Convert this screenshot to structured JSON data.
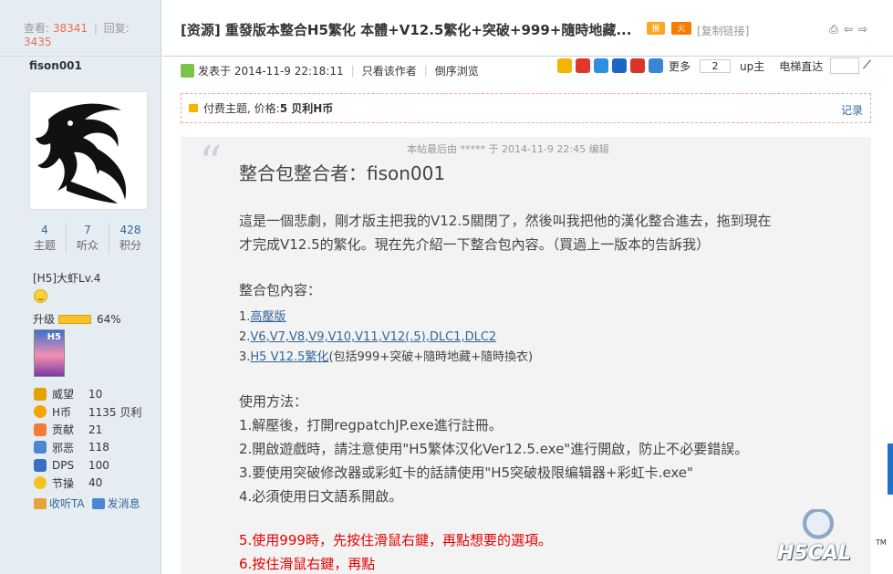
{
  "left": {
    "stats": {
      "views_label": "查看:",
      "views": "38341",
      "replies_label": "回复:",
      "replies": "3435"
    },
    "username": "fison001",
    "counts": [
      {
        "num": "4",
        "label": "主题"
      },
      {
        "num": "7",
        "label": "听众"
      },
      {
        "num": "428",
        "label": "积分"
      }
    ],
    "rank": "[H5]大虾Lv.4",
    "level_label": "升级",
    "level_pct": "64%",
    "medal_text": "H5",
    "attrs": [
      {
        "icon": "crown-icon",
        "label": "威望",
        "value": "10",
        "color": "#e4a400"
      },
      {
        "icon": "coin-icon",
        "label": "H币",
        "value": "1135 贝利",
        "color": "#f5a500"
      },
      {
        "icon": "heart-icon",
        "label": "贡献",
        "value": "21",
        "color": "#f27b38"
      },
      {
        "icon": "evil-icon",
        "label": "邪恶",
        "value": "118",
        "color": "#4a88d0"
      },
      {
        "icon": "dps-icon",
        "label": "DPS",
        "value": "100",
        "color": "#3a6fc2"
      },
      {
        "icon": "bulb-icon",
        "label": "节操",
        "value": "40",
        "color": "#f4c220"
      }
    ],
    "actions": [
      {
        "icon": "follow-icon",
        "label": "收听TA"
      },
      {
        "icon": "message-icon",
        "label": "发消息"
      }
    ]
  },
  "topbar": {
    "title": "[资源] 重發版本整合H5繁化 本體+V12.5繁化+突破+999+隨時地藏...",
    "badge1": "推",
    "badge2": "火",
    "copy_link": "[复制链接]"
  },
  "author": {
    "posted": "发表于 2014-11-9 22:18:11",
    "only_author": "只看该作者",
    "reverse": "倒序浏览",
    "more": "更多",
    "page_count": "2",
    "up": "up主",
    "elevator": "电梯直达"
  },
  "pay": {
    "text": "付费主题, 价格: ",
    "price": "5 贝利H币",
    "record": "记录"
  },
  "post": {
    "edit_note": "本帖最后由 ***** 于 2014-11-9 22:45 编辑",
    "heading": "整合包整合者：fison001",
    "para1": "這是一個悲劇，剛才版主把我的V12.5關閉了，然後叫我把他的漢化整合進去，拖到現在",
    "para2": "才完成V12.5的繁化。現在先介紹一下整合包內容。（買過上一版本的告訴我）",
    "content_title": "整合包內容：",
    "items": [
      {
        "num": "1.",
        "link": "高壓版",
        "rest": ""
      },
      {
        "num": "2.",
        "link": "V6,V7,V8,V9,V10,V11,V12(.5),DLC1,DLC2",
        "rest": ""
      },
      {
        "num": "3.",
        "link": "H5 V12.5繁化",
        "rest": "(包括999+突破+隨時地藏+隨時換衣)"
      }
    ],
    "usage_title": "使用方法：",
    "steps": [
      "1.解壓後，打開regpatchJP.exe進行註冊。",
      "2.開啟遊戲時，請注意使用\"H5繁体汉化Ver12.5.exe\"進行開啟，防止不必要錯誤。",
      "3.要使用突破修改器或彩虹卡的話請使用\"H5突破极限编辑器+彩虹卡.exe\"",
      "4.必須使用日文語系開啟。"
    ],
    "red_steps": [
      "5.使用999時，先按住滑鼠右鍵，再點想要的選項。",
      "6.按住滑鼠右鍵，再點"
    ]
  },
  "logo": {
    "text": "H5CAL",
    "tm": "TM"
  }
}
